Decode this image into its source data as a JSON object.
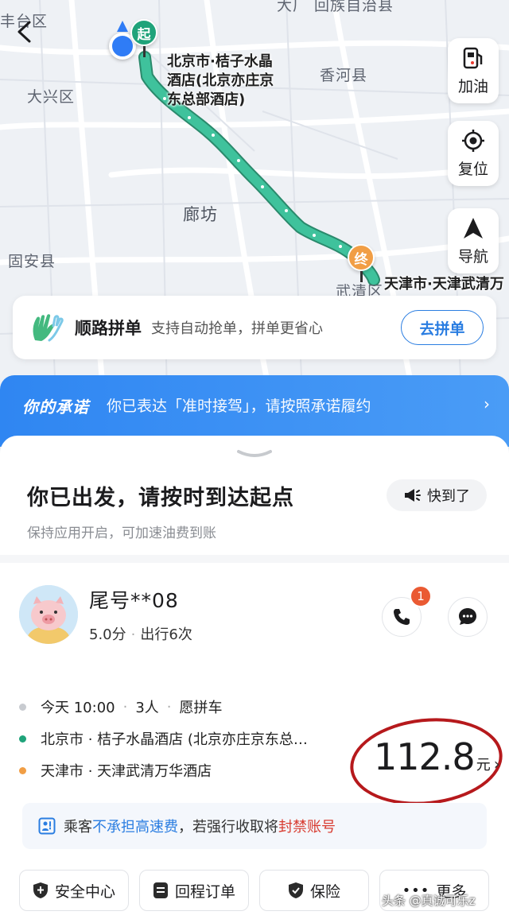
{
  "map": {
    "labels": {
      "fengtai": "丰台区",
      "daxing": "大兴区",
      "top_partial": "大厂 回族自治县",
      "xianghe": "香河县",
      "langfang": "廊坊",
      "guan": "固安县",
      "wuqing": "武清区"
    },
    "start_pin": "起",
    "end_pin": "终",
    "start_label": "北京市·桔子水晶\n酒店(北京亦庄京\n东总部酒店)",
    "end_label": "天津市·天津武清万",
    "route_color": "#3bb08f",
    "buttons": {
      "fuel": "加油",
      "recenter": "复位",
      "navigate": "导航"
    }
  },
  "carpool": {
    "title": "顺路拼单",
    "subtitle": "支持自动抢单，拼单更省心",
    "button": "去拼单"
  },
  "promise": {
    "brand": "你的承诺",
    "message": "你已表达「准时接驾」，请按照承诺履约"
  },
  "status": {
    "title": "你已出发，请按时到达起点",
    "subtitle": "保持应用开启，可加速油费到账",
    "soon_button": "快到了"
  },
  "passenger": {
    "name": "尾号**08",
    "rating": "5.0分",
    "trips": "出行6次",
    "unread_badge": "1"
  },
  "trip": {
    "time": "今天 10:00",
    "people": "3人",
    "pool": "愿拼车",
    "origin": "北京市 · 桔子水晶酒店 (北京亦庄京东总…",
    "destination": "天津市 · 天津武清万华酒店",
    "price": "112.8",
    "price_unit": "元"
  },
  "notice": {
    "prefix": "乘客",
    "highlight": "不承担高速费",
    "middle": "，若强行收取将",
    "warning": "封禁账号"
  },
  "bottom_actions": {
    "safety": "安全中心",
    "return_order": "回程订单",
    "insurance": "保险",
    "more": "更多"
  },
  "watermark": "头条 @真诚可乐z",
  "colors": {
    "accent_blue": "#2a7de1",
    "start_green": "#1fa37a",
    "end_orange": "#f19e45",
    "alert_red": "#d83b30"
  }
}
